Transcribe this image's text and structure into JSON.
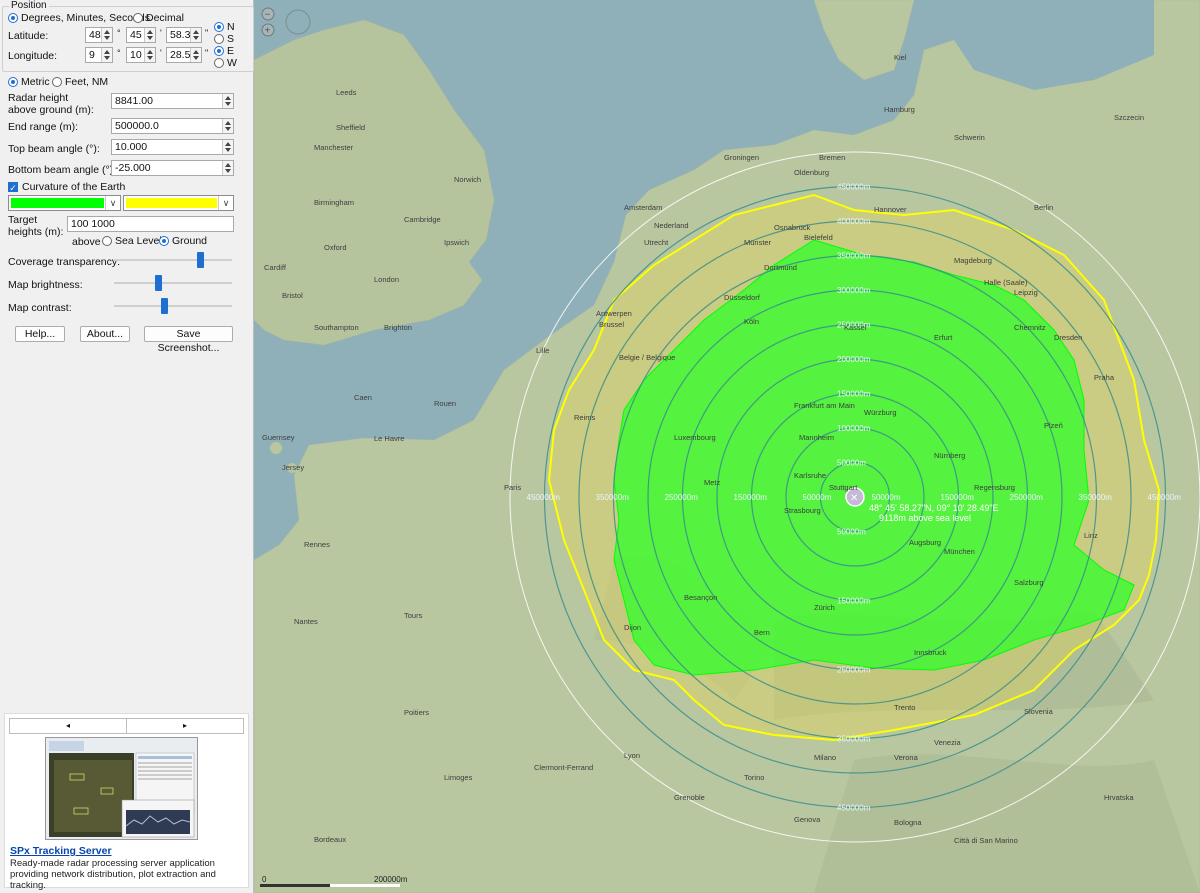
{
  "position": {
    "group_title": "Position",
    "format_options": [
      "Degrees, Minutes, Seconds",
      "Decimal"
    ],
    "selected_format": "Degrees, Minutes, Seconds",
    "latitude_label": "Latitude:",
    "latitude": {
      "deg": "48",
      "min": "45",
      "sec": "58.3"
    },
    "longitude_label": "Longitude:",
    "longitude": {
      "deg": "9",
      "min": "10",
      "sec": "28.5"
    },
    "lat_hemisphere_options": [
      "N",
      "S"
    ],
    "lat_hemisphere": "N",
    "lon_hemisphere_options": [
      "E",
      "W"
    ],
    "lon_hemisphere": "E",
    "deg_symbol": "°",
    "min_symbol": "'",
    "sec_symbol": "\""
  },
  "units": {
    "options": [
      "Metric",
      "Feet, NM"
    ],
    "selected": "Metric"
  },
  "fields": {
    "radar_height_label": "Radar height\nabove ground (m):",
    "radar_height": "8841.00",
    "end_range_label": "End range (m):",
    "end_range": "500000.0",
    "top_beam_label": "Top beam angle (°):",
    "top_beam": "10.000",
    "bottom_beam_label": "Bottom beam angle (°):",
    "bottom_beam": "-25.000"
  },
  "curvature": {
    "label": "Curvature of the Earth",
    "checked": true
  },
  "colors": {
    "coverage_1": "#00ff00",
    "coverage_2": "#ffff00"
  },
  "target": {
    "label": "Target\nheights (m):",
    "value": "100 1000",
    "above_label": "above",
    "reference_options": [
      "Sea Level",
      "Ground"
    ],
    "reference": "Ground"
  },
  "sliders": {
    "coverage_transparency_label": "Coverage transparency:",
    "coverage_transparency": 0.75,
    "map_brightness_label": "Map brightness:",
    "map_brightness": 0.37,
    "map_contrast_label": "Map contrast:",
    "map_contrast": 0.42
  },
  "buttons": {
    "help": "Help...",
    "about": "About...",
    "save_screenshot": "Save Screenshot..."
  },
  "promo": {
    "prev": "◂",
    "next": "▸",
    "title": "SPx Tracking Server",
    "description": "Ready-made radar processing server application providing network distribution, plot extraction and tracking."
  },
  "map": {
    "radar_readout_line1": "48° 45' 58.27\"N, 09° 10' 28.49\"E",
    "radar_readout_line2": "9118m above sea level",
    "ring_labels": [
      "50000m",
      "150000m",
      "250000m",
      "350000m",
      "450000m"
    ],
    "ring_labels_inner": [
      "100000m",
      "200000m",
      "300000m",
      "400000m"
    ],
    "scale_zero": "0",
    "scale_label": "200000m",
    "cities": [
      {
        "name": "London"
      },
      {
        "name": "Birmingham"
      },
      {
        "name": "Manchester"
      },
      {
        "name": "Leeds"
      },
      {
        "name": "Sheffield"
      },
      {
        "name": "Bristol"
      },
      {
        "name": "Cambridge"
      },
      {
        "name": "Norwich"
      },
      {
        "name": "Amsterdam"
      },
      {
        "name": "Utrecht"
      },
      {
        "name": "Nederland"
      },
      {
        "name": "Antwerpen"
      },
      {
        "name": "Brussel"
      },
      {
        "name": "Belgie / Belgique"
      },
      {
        "name": "Lille"
      },
      {
        "name": "Luxembourg"
      },
      {
        "name": "Paris"
      },
      {
        "name": "Rouen"
      },
      {
        "name": "Caen"
      },
      {
        "name": "Le Havre"
      },
      {
        "name": "Rennes"
      },
      {
        "name": "Nantes"
      },
      {
        "name": "Tours"
      },
      {
        "name": "Poitiers"
      },
      {
        "name": "Bordeaux"
      },
      {
        "name": "Limoges"
      },
      {
        "name": "Clermont-Ferrand"
      },
      {
        "name": "Lyon"
      },
      {
        "name": "Dijon"
      },
      {
        "name": "Metz"
      },
      {
        "name": "Strasbourg"
      },
      {
        "name": "Frankfurt am Main"
      },
      {
        "name": "Köln"
      },
      {
        "name": "Düsseldorf"
      },
      {
        "name": "Dortmund"
      },
      {
        "name": "Bremen"
      },
      {
        "name": "Hamburg"
      },
      {
        "name": "Hannover"
      },
      {
        "name": "Berlin"
      },
      {
        "name": "Leipzig"
      },
      {
        "name": "Dresden"
      },
      {
        "name": "Nürnberg"
      },
      {
        "name": "München"
      },
      {
        "name": "Augsburg"
      },
      {
        "name": "Zürich"
      },
      {
        "name": "Bern"
      },
      {
        "name": "Milano"
      },
      {
        "name": "Torino"
      },
      {
        "name": "Genova"
      },
      {
        "name": "Venezia"
      },
      {
        "name": "Slovenia"
      },
      {
        "name": "Hrvatska"
      },
      {
        "name": "Praha"
      },
      {
        "name": "Plzeň"
      },
      {
        "name": "Linz"
      },
      {
        "name": "Innsbruck"
      },
      {
        "name": "Szczecin"
      },
      {
        "name": "Schwerin"
      },
      {
        "name": "Kiel"
      },
      {
        "name": "Magdeburg"
      },
      {
        "name": "Erfurt"
      },
      {
        "name": "Kassel"
      },
      {
        "name": "Würzburg"
      },
      {
        "name": "Regensburg"
      },
      {
        "name": "Salzburg"
      },
      {
        "name": "Besançon"
      },
      {
        "name": "Reims"
      },
      {
        "name": "Jersey"
      },
      {
        "name": "Guernsey"
      },
      {
        "name": "Brighton"
      },
      {
        "name": "Southampton"
      },
      {
        "name": "Cardiff"
      },
      {
        "name": "Oxford"
      },
      {
        "name": "Ipswich"
      },
      {
        "name": "Groningen"
      },
      {
        "name": "Oldenburg"
      },
      {
        "name": "Osnabrück"
      },
      {
        "name": "Bielefeld"
      },
      {
        "name": "Münster"
      },
      {
        "name": "Halle (Saale)"
      },
      {
        "name": "Chemnitz"
      },
      {
        "name": "Mannheim"
      },
      {
        "name": "Karlsruhe"
      },
      {
        "name": "Stuttgart"
      },
      {
        "name": "Grenoble"
      },
      {
        "name": "Bologna"
      },
      {
        "name": "Verona"
      },
      {
        "name": "Trento"
      },
      {
        "name": "Città di San Marino"
      }
    ]
  }
}
